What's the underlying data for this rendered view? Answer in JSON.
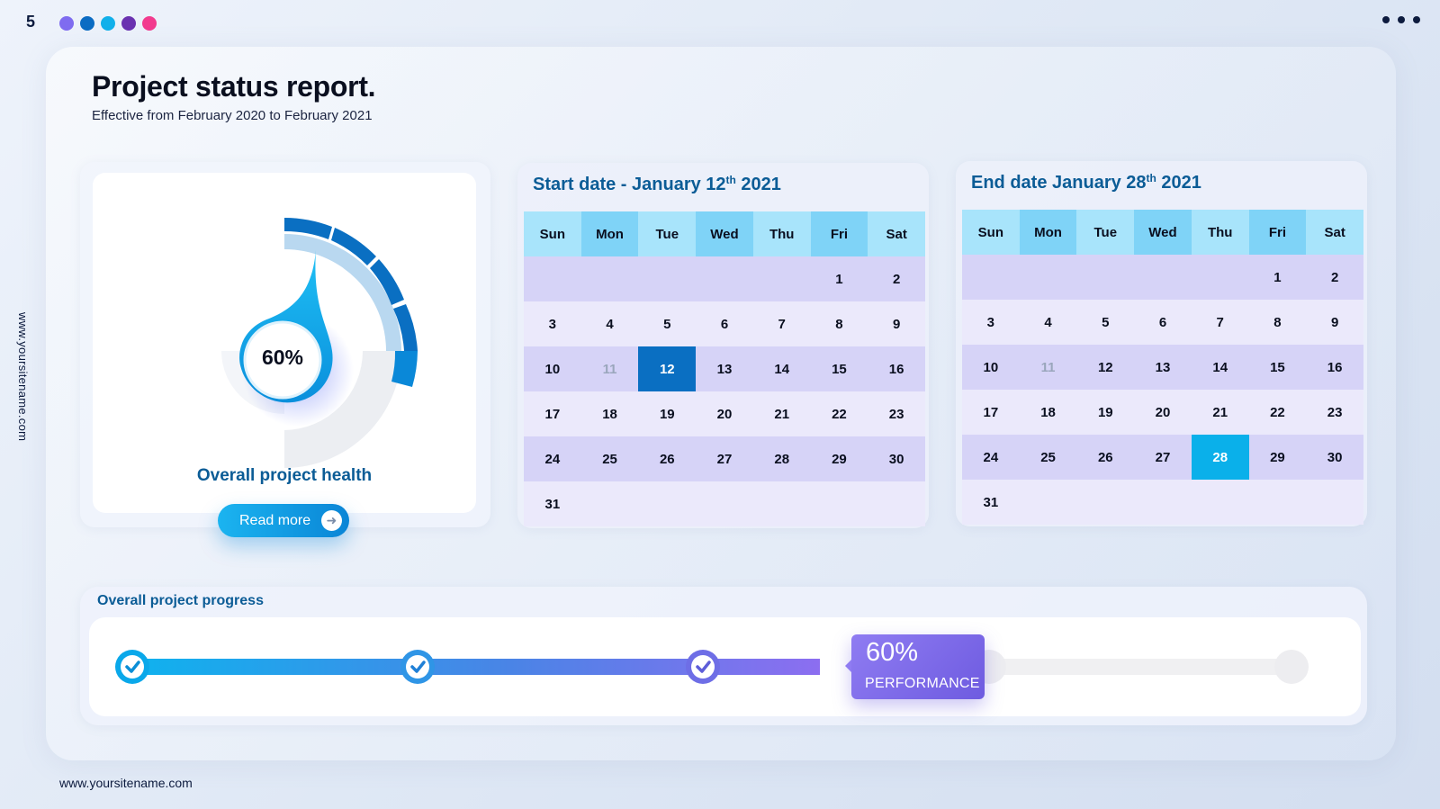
{
  "page_number": "5",
  "header": {
    "dot_colors": [
      "#7f6cf0",
      "#0b6cc3",
      "#11b0ea",
      "#6a32b0",
      "#f23b8e"
    ]
  },
  "side_url": "www.yoursitename.com",
  "footer_url": "www.yoursitename.com",
  "title": "Project status report.",
  "subtitle": "Effective from February 2020 to February 2021",
  "health": {
    "percent_label": "60%",
    "percent": 60,
    "label": "Overall project health",
    "read_more": "Read more"
  },
  "start_calendar": {
    "title_prefix": "Start date - January 12",
    "title_sup": "th",
    "title_suffix": " 2021",
    "weekdays": [
      "Sun",
      "Mon",
      "Tue",
      "Wed",
      "Thu",
      "Fri",
      "Sat"
    ],
    "days": [
      "",
      "",
      "",
      "",
      "",
      "1",
      "2",
      "3",
      "4",
      "5",
      "6",
      "7",
      "8",
      "9",
      "10",
      "11",
      "12",
      "13",
      "14",
      "15",
      "16",
      "17",
      "18",
      "19",
      "20",
      "21",
      "22",
      "23",
      "24",
      "25",
      "26",
      "27",
      "28",
      "29",
      "30",
      "31"
    ],
    "selected_day": "12",
    "muted_day": "11"
  },
  "end_calendar": {
    "title_prefix": "End date January  28",
    "title_sup": "th",
    "title_suffix": " 2021",
    "weekdays": [
      "Sun",
      "Mon",
      "Tue",
      "Wed",
      "Thu",
      "Fri",
      "Sat"
    ],
    "days": [
      "",
      "",
      "",
      "",
      "",
      "1",
      "2",
      "3",
      "4",
      "5",
      "6",
      "7",
      "8",
      "9",
      "10",
      "11",
      "12",
      "13",
      "14",
      "15",
      "16",
      "17",
      "18",
      "19",
      "20",
      "21",
      "22",
      "23",
      "24",
      "25",
      "26",
      "27",
      "28",
      "29",
      "30",
      "31"
    ],
    "selected_day": "28",
    "muted_day": "11"
  },
  "progress": {
    "title": "Overall project progress",
    "percent": 60,
    "badge_pct": "60%",
    "badge_label": "PERFORMANCE",
    "milestones_completed": 3,
    "milestones_total": 5
  },
  "colors": {
    "accent_blue": "#0b5c96",
    "cyan": "#0ab0ea",
    "purple": "#7f6cf0",
    "selected_dark": "#0a6fc2",
    "header_cyan": "#a8e4fb",
    "row_lavender": "#d6d3f7",
    "row_light": "#ebe9fb"
  }
}
